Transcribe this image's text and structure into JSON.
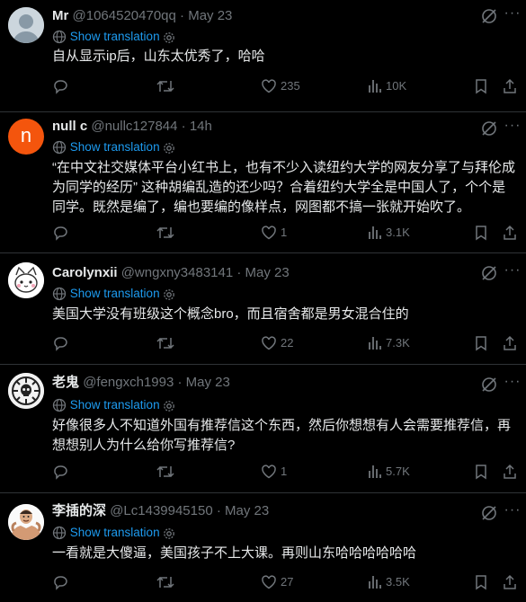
{
  "ui": {
    "show_translation": "Show translation",
    "dot": "·"
  },
  "colors": {
    "background": "#000000",
    "text": "#e7e9ea",
    "muted": "#71767b",
    "link": "#1d9bf0",
    "divider": "#2f3336"
  },
  "tweets": [
    {
      "name": "Mr",
      "handle": "@1064520470qq",
      "time": "May 23",
      "avatar": "default-grey-avatar",
      "text_lines": [
        "自从显示ip后，山东太优秀了，哈哈"
      ],
      "replies": "",
      "retweets": "",
      "likes": "235",
      "views": "10K"
    },
    {
      "name": "null c",
      "handle": "@nullc127844",
      "time": "14h",
      "avatar": "letter-n-orange-avatar",
      "avatar_letter": "n",
      "text_lines": [
        "“在中文社交媒体平台小红书上，也有不少入读纽约大学的网友分享了与拜伦成",
        "为同学的经历” 这种胡编乱造的还少吗？合着纽约大学全是中国人了，个个是",
        "同学。既然是编了，编也要编的像样点，网图都不搞一张就开始吹了。"
      ],
      "replies": "",
      "retweets": "",
      "likes": "1",
      "views": "3.1K"
    },
    {
      "name": "Carolynxii",
      "handle": "@wngxny3483141",
      "time": "May 23",
      "avatar": "cartoon-cat-avatar",
      "show_translation": false,
      "text_lines": [
        "美国大学没有班级这个概念bro，而且宿舍都是男女混合住的"
      ],
      "replies": "",
      "retweets": "",
      "likes": "22",
      "views": "7.3K"
    },
    {
      "name": "老鬼",
      "handle": "@fengxch1993",
      "time": "May 23",
      "avatar": "hydra-skull-emblem-avatar",
      "text_lines": [
        "好像很多人不知道外国有推荐信这个东西，然后你想想有人会需要推荐信，再",
        "想想别人为什么给你写推荐信?"
      ],
      "replies": "",
      "retweets": "",
      "likes": "1",
      "views": "5.7K"
    },
    {
      "name": "李插的深",
      "handle": "@Lc1439945150",
      "time": "May 23",
      "avatar": "muscular-man-avatar",
      "text_lines": [
        "一看就是大傻逼，美国孩子不上大课。再则山东哈哈哈哈哈哈"
      ],
      "replies": "",
      "retweets": "",
      "likes": "27",
      "views": "3.5K"
    }
  ]
}
